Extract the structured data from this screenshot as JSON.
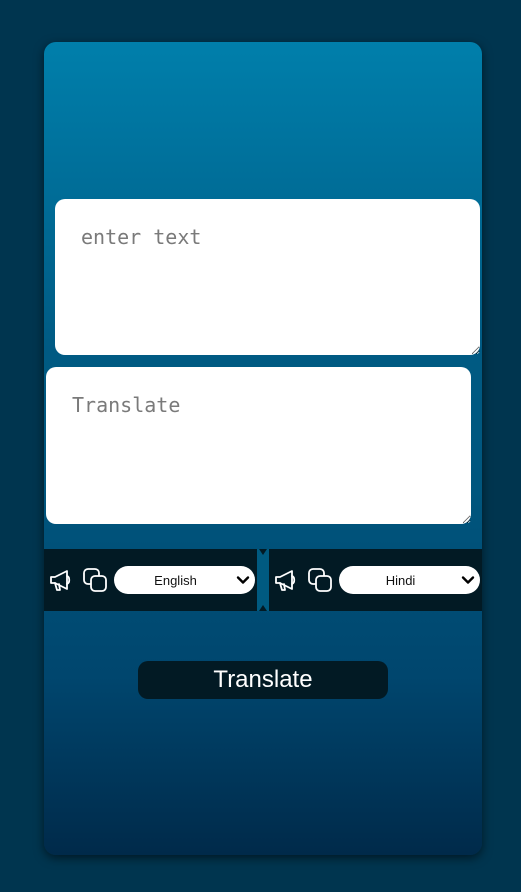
{
  "input": {
    "placeholder": "enter text"
  },
  "output": {
    "placeholder": "Translate"
  },
  "from_lang": {
    "selected": "English",
    "speak_icon": "megaphone-icon",
    "copy_icon": "copy-icon"
  },
  "to_lang": {
    "selected": "Hindi",
    "speak_icon": "megaphone-icon",
    "copy_icon": "copy-icon"
  },
  "translate_button": {
    "label": "Translate"
  },
  "colors": {
    "page_bg": "#00354f",
    "card_top": "#007fab",
    "card_bottom": "#002a4a",
    "controls_bg": "#021a24",
    "button_bg": "#021a24",
    "field_bg": "#ffffff"
  }
}
